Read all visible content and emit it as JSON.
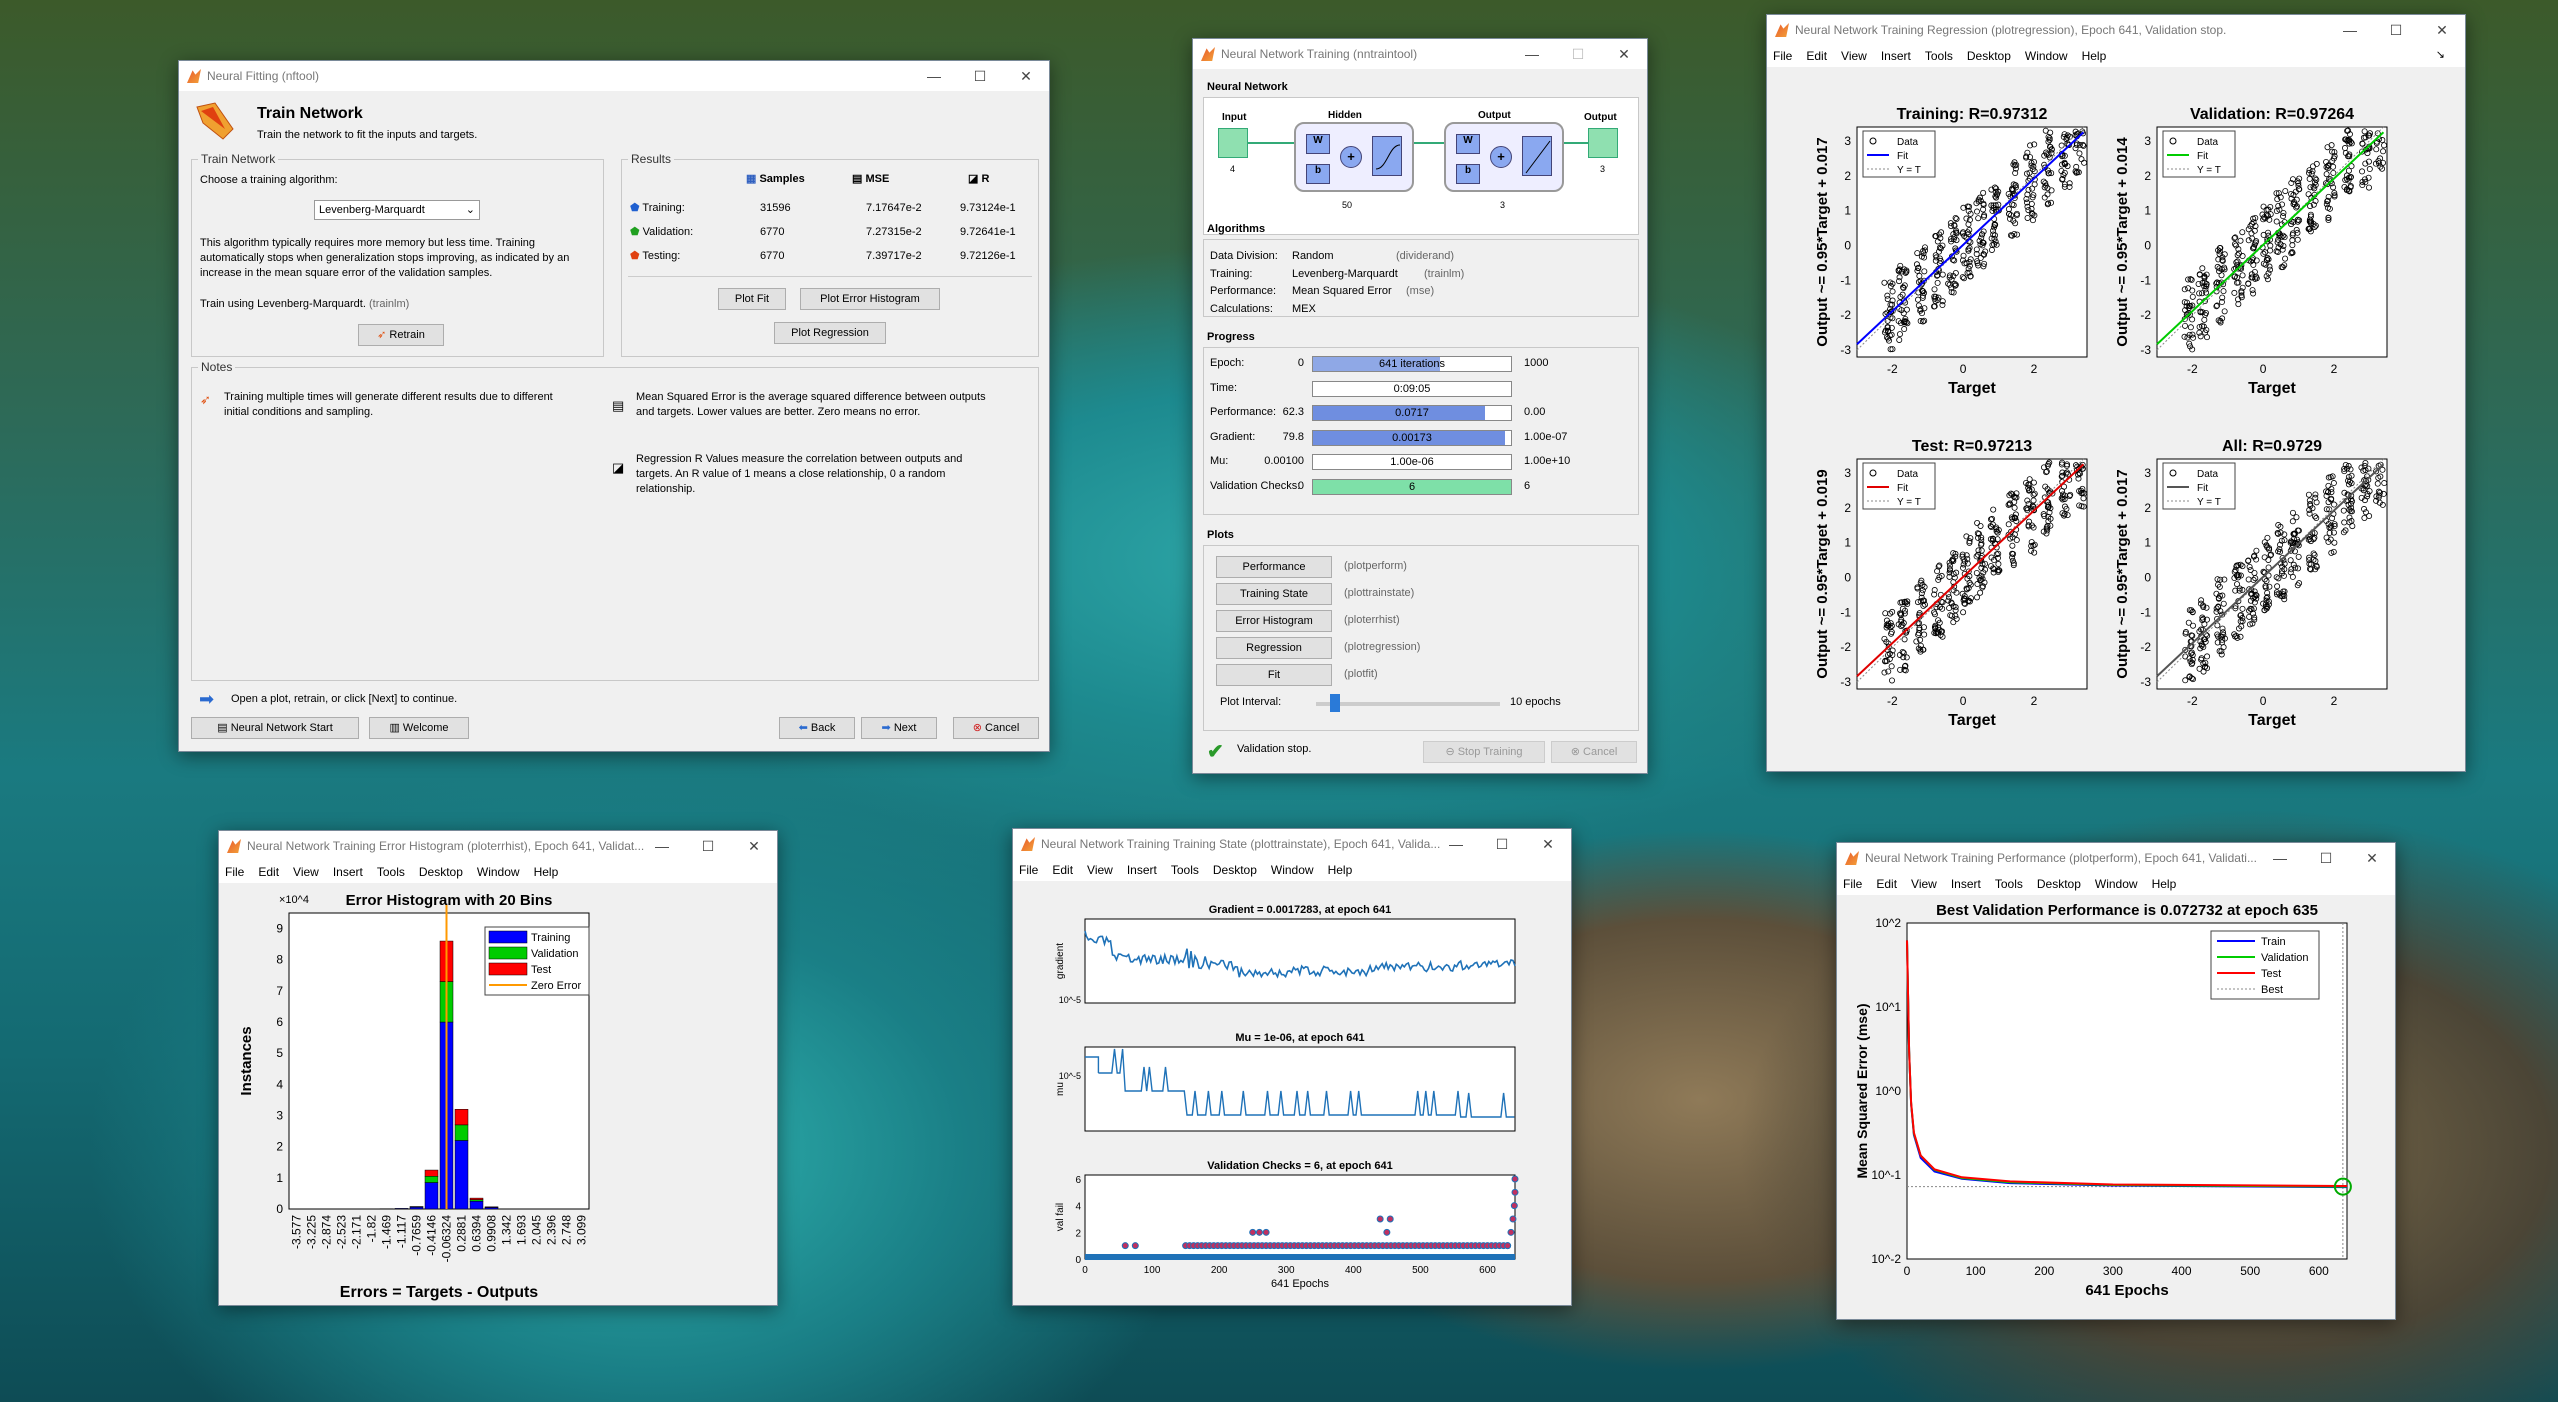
{
  "nftool": {
    "title": "Neural Fitting (nftool)",
    "heading": "Train Network",
    "subheading": "Train the network to fit the inputs and targets.",
    "train_group": "Train Network",
    "choose_label": "Choose a training algorithm:",
    "algo_select": "Levenberg-Marquardt",
    "algo_desc": "This algorithm typically requires more memory but less time. Training automatically stops when generalization stops improving, as indicated by an increase in the mean square error of the validation samples.",
    "train_using": "Train using Levenberg-Marquardt.",
    "train_using_fn": "(trainlm)",
    "retrain": "Retrain",
    "results_group": "Results",
    "col_samples": "Samples",
    "col_mse": "MSE",
    "col_r": "R",
    "rows": [
      {
        "label": "Training:",
        "samples": "31596",
        "mse": "7.17647e-2",
        "r": "9.73124e-1"
      },
      {
        "label": "Validation:",
        "samples": "6770",
        "mse": "7.27315e-2",
        "r": "9.72641e-1"
      },
      {
        "label": "Testing:",
        "samples": "6770",
        "mse": "7.39717e-2",
        "r": "9.72126e-1"
      }
    ],
    "plot_fit": "Plot Fit",
    "plot_err_hist": "Plot Error Histogram",
    "plot_regression": "Plot Regression",
    "notes_group": "Notes",
    "note1": "Training multiple times will generate different results due to different initial conditions and sampling.",
    "note2": "Mean Squared Error is the average squared difference between outputs and targets. Lower values are better. Zero means no error.",
    "note3": "Regression R Values measure the correlation between outputs and targets. An R value of 1 means a close relationship, 0 a random relationship.",
    "hint": "Open a plot, retrain, or click [Next] to continue.",
    "nn_start": "Neural Network Start",
    "welcome": "Welcome",
    "back": "Back",
    "next": "Next",
    "cancel": "Cancel"
  },
  "nntraintool": {
    "title": "Neural Network Training (nntraintool)",
    "nn_group": "Neural Network",
    "input": "Input",
    "input_n": "4",
    "hidden": "Hidden",
    "hidden_n": "50",
    "output": "Output",
    "output_n": "3",
    "output_out": "Output",
    "output_out_n": "3",
    "w": "W",
    "b": "b",
    "algo_group": "Algorithms",
    "algos": [
      {
        "k": "Data Division:",
        "v": "Random",
        "f": "(dividerand)"
      },
      {
        "k": "Training:",
        "v": "Levenberg-Marquardt",
        "f": "(trainlm)"
      },
      {
        "k": "Performance:",
        "v": "Mean Squared Error",
        "f": "(mse)"
      },
      {
        "k": "Calculations:",
        "v": "MEX",
        "f": ""
      }
    ],
    "prog_group": "Progress",
    "progress": [
      {
        "k": "Epoch:",
        "min": "0",
        "val": "641 iterations",
        "max": "1000",
        "frac": 0.64,
        "color": "#8fa8e6"
      },
      {
        "k": "Time:",
        "min": "",
        "val": "0:09:05",
        "max": "",
        "frac": 0,
        "color": "#8fa8e6"
      },
      {
        "k": "Performance:",
        "min": "62.3",
        "val": "0.0717",
        "max": "0.00",
        "frac": 0.87,
        "color": "#6f8ee0"
      },
      {
        "k": "Gradient:",
        "min": "79.8",
        "val": "0.00173",
        "max": "1.00e-07",
        "frac": 0.97,
        "color": "#6f8ee0"
      },
      {
        "k": "Mu:",
        "min": "0.00100",
        "val": "1.00e-06",
        "max": "1.00e+10",
        "frac": 0,
        "color": "#6f8ee0"
      },
      {
        "k": "Validation Checks:",
        "min": "0",
        "val": "6",
        "max": "6",
        "frac": 1,
        "color": "#7ee0a8"
      }
    ],
    "plots_group": "Plots",
    "plots": [
      {
        "b": "Performance",
        "f": "(plotperform)"
      },
      {
        "b": "Training State",
        "f": "(plottrainstate)"
      },
      {
        "b": "Error Histogram",
        "f": "(ploterrhist)"
      },
      {
        "b": "Regression",
        "f": "(plotregression)"
      },
      {
        "b": "Fit",
        "f": "(plotfit)"
      }
    ],
    "plot_interval": "Plot Interval:",
    "plot_interval_val": "10 epochs",
    "status": "Validation stop.",
    "stop_training": "Stop Training",
    "cancel": "Cancel"
  },
  "regression": {
    "title": "Neural Network Training Regression (plotregression), Epoch 641, Validation stop.",
    "menu": [
      "File",
      "Edit",
      "View",
      "Insert",
      "Tools",
      "Desktop",
      "Window",
      "Help"
    ],
    "plots": [
      {
        "title": "Training: R=0.97312",
        "ylabel": "Output ~= 0.95*Target + 0.017",
        "xlabel": "Target",
        "fit": "#0000ff"
      },
      {
        "title": "Validation: R=0.97264",
        "ylabel": "Output ~= 0.95*Target + 0.014",
        "xlabel": "Target",
        "fit": "#00cc00"
      },
      {
        "title": "Test: R=0.97213",
        "ylabel": "Output ~= 0.95*Target + 0.019",
        "xlabel": "Target",
        "fit": "#e00000"
      },
      {
        "title": "All: R=0.9729",
        "ylabel": "Output ~= 0.95*Target + 0.017",
        "xlabel": "Target",
        "fit": "#555555"
      }
    ],
    "legend": [
      "Data",
      "Fit",
      "Y = T"
    ],
    "xticks": [
      "-2",
      "0",
      "2"
    ],
    "yticks": [
      "3",
      "2",
      "1",
      "0",
      "-1",
      "-2",
      "-3"
    ]
  },
  "errhist": {
    "title": "Neural Network Training Error Histogram (ploterrhist), Epoch 641, Validat...",
    "menu": [
      "File",
      "Edit",
      "View",
      "Insert",
      "Tools",
      "Desktop",
      "Window",
      "Help"
    ]
  },
  "trainstate": {
    "title": "Neural Network Training Training State (plottrainstate), Epoch 641, Valida...",
    "menu": [
      "File",
      "Edit",
      "View",
      "Insert",
      "Tools",
      "Desktop",
      "Window",
      "Help"
    ],
    "g_title": "Gradient = 0.0017283, at epoch 641",
    "g_ylabel": "gradient",
    "mu_title": "Mu = 1e-06, at epoch 641",
    "mu_ylabel": "mu",
    "v_title": "Validation Checks = 6, at epoch 641",
    "v_ylabel": "val fail",
    "xlabel": "641 Epochs",
    "xticks": [
      "0",
      "100",
      "200",
      "300",
      "400",
      "500",
      "600"
    ],
    "v_yticks": [
      "6",
      "4",
      "2",
      "0"
    ],
    "g_ymin": "10^-5",
    "mu_ymid": "10^-5"
  },
  "perform": {
    "title": "Neural Network Training Performance (plotperform), Epoch 641, Validati...",
    "menu": [
      "File",
      "Edit",
      "View",
      "Insert",
      "Tools",
      "Desktop",
      "Window",
      "Help"
    ]
  },
  "chart_data": [
    {
      "type": "bar",
      "title": "Error Histogram with 20 Bins",
      "xlabel": "Errors = Targets - Outputs",
      "ylabel": "Instances",
      "y_exponent": "×10^4",
      "ylim": [
        0,
        9.5
      ],
      "categories": [
        "-3.577",
        "-3.225",
        "-2.874",
        "-2.523",
        "-2.171",
        "-1.82",
        "-1.469",
        "-1.117",
        "-0.7659",
        "-0.4146",
        "-0.06324",
        "0.2881",
        "0.6394",
        "0.9908",
        "1.342",
        "1.693",
        "2.045",
        "2.396",
        "2.748",
        "3.099"
      ],
      "series": [
        {
          "name": "Training",
          "color": "#0000ff",
          "values": [
            0,
            0,
            0,
            0,
            0,
            0,
            0.01,
            0.02,
            0.06,
            0.85,
            6.0,
            2.2,
            0.25,
            0.05,
            0,
            0,
            0,
            0,
            0,
            0
          ]
        },
        {
          "name": "Validation",
          "color": "#00cc00",
          "values": [
            0,
            0,
            0,
            0,
            0,
            0,
            0,
            0,
            0.01,
            0.2,
            1.3,
            0.5,
            0.05,
            0.01,
            0,
            0,
            0,
            0,
            0,
            0
          ]
        },
        {
          "name": "Test",
          "color": "#ff0000",
          "values": [
            0,
            0,
            0,
            0,
            0,
            0,
            0,
            0,
            0.01,
            0.2,
            1.3,
            0.5,
            0.05,
            0.01,
            0,
            0,
            0,
            0,
            0,
            0
          ]
        }
      ],
      "legend": [
        "Training",
        "Validation",
        "Test",
        "Zero Error"
      ],
      "zero_error": -0.06324,
      "yticks": [
        "0",
        "1",
        "2",
        "3",
        "4",
        "5",
        "6",
        "7",
        "8",
        "9"
      ]
    },
    {
      "type": "line",
      "title": "Best Validation Performance is 0.072732 at epoch 635",
      "xlabel": "641 Epochs",
      "ylabel": "Mean Squared Error  (mse)",
      "yscale": "log",
      "ylim": [
        0.01,
        100
      ],
      "xlim": [
        0,
        641
      ],
      "xticks": [
        "0",
        "100",
        "200",
        "300",
        "400",
        "500",
        "600"
      ],
      "yticks": [
        "10^2",
        "10^1",
        "10^0",
        "10^-1",
        "10^-2"
      ],
      "series": [
        {
          "name": "Train",
          "color": "#0000ff",
          "x": [
            0,
            3,
            6,
            10,
            20,
            40,
            80,
            150,
            300,
            635,
            641
          ],
          "y": [
            62,
            3,
            0.7,
            0.3,
            0.16,
            0.11,
            0.09,
            0.08,
            0.075,
            0.0718,
            0.0717
          ]
        },
        {
          "name": "Validation",
          "color": "#00cc00",
          "x": [
            0,
            3,
            6,
            10,
            20,
            40,
            80,
            150,
            300,
            635,
            641
          ],
          "y": [
            62,
            3,
            0.72,
            0.31,
            0.17,
            0.115,
            0.092,
            0.082,
            0.076,
            0.0727,
            0.073
          ]
        },
        {
          "name": "Test",
          "color": "#ff0000",
          "x": [
            0,
            3,
            6,
            10,
            20,
            40,
            80,
            150,
            300,
            635,
            641
          ],
          "y": [
            62,
            3,
            0.73,
            0.32,
            0.17,
            0.117,
            0.094,
            0.084,
            0.077,
            0.074,
            0.074
          ]
        }
      ],
      "legend": [
        "Train",
        "Validation",
        "Test",
        "Best"
      ],
      "best": {
        "x": 635,
        "y": 0.072732
      }
    }
  ]
}
